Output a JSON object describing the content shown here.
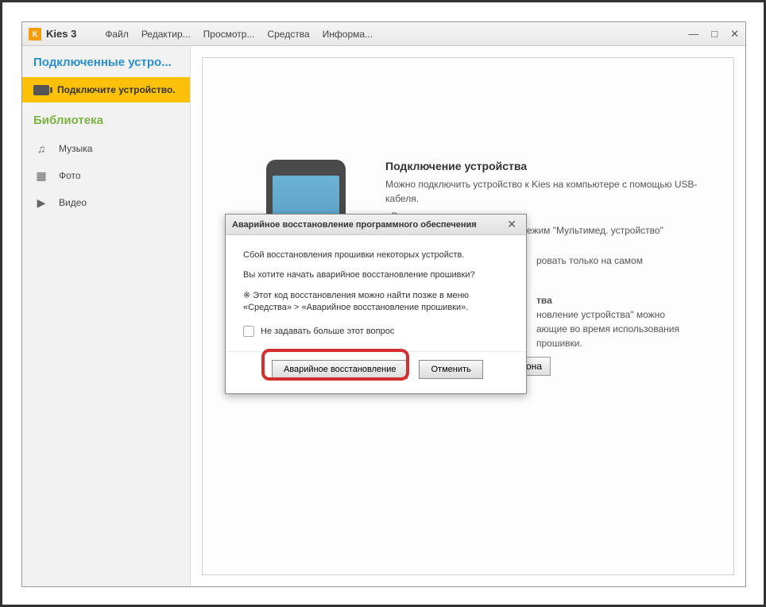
{
  "app": {
    "title": "Kies 3",
    "icon_label": "K"
  },
  "menu": {
    "items": [
      "Файл",
      "Редактир...",
      "Просмотр...",
      "Средства",
      "Информа..."
    ]
  },
  "window_controls": {
    "minimize": "—",
    "maximize": "□",
    "close": "✕"
  },
  "sidebar": {
    "connected_header": "Подключенные устро...",
    "active_item": "Подключите устройство.",
    "library_header": "Библиотека",
    "items": [
      {
        "icon": "♫",
        "label": "Музыка"
      },
      {
        "icon": "▦",
        "label": "Фото"
      },
      {
        "icon": "▶",
        "label": "Видео"
      }
    ]
  },
  "main": {
    "connection": {
      "title": "Подключение устройства",
      "subtitle": "Можно подключить устройство к Kies на компьютере с помощью USB-кабеля.",
      "bullet": "• Режим подключения",
      "bullet_text": "Для подключения выберите режим \"Мультимед. устройство\"",
      "partial1": "ровать только на самом",
      "partial2": "тва",
      "partial3": "новление устройства\" можно",
      "partial4": "ающие во время использования",
      "partial5": "прошивки.",
      "action_btn": "телефона"
    }
  },
  "dialog": {
    "title": "Аварийное восстановление программного обеспечения",
    "line1": "Сбой восстановления прошивки некоторых устройств.",
    "line2": "Вы хотите начать аварийное восстановление прошивки?",
    "line3": "※ Этот код восстановления можно найти позже в меню «Средства» > «Аварийное восстановление прошивки».",
    "checkbox_label": "Не задавать больше этот вопрос",
    "btn_recover": "Аварийное восстановление",
    "btn_cancel": "Отменить"
  }
}
